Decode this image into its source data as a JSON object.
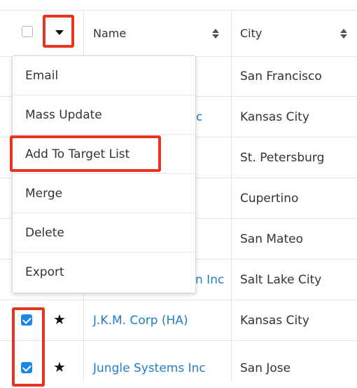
{
  "header": {
    "name_label": "Name",
    "city_label": "City"
  },
  "rows": [
    {
      "name": "",
      "city": "San Francisco",
      "checked": false,
      "starred": false
    },
    {
      "name": "c",
      "city": "Kansas City",
      "checked": false,
      "starred": false
    },
    {
      "name": "",
      "city": "St. Petersburg",
      "checked": false,
      "starred": false
    },
    {
      "name": "",
      "city": "Cupertino",
      "checked": false,
      "starred": false
    },
    {
      "name": "",
      "city": "San Mateo",
      "checked": false,
      "starred": false
    },
    {
      "name": "n Inc",
      "city": "Salt Lake City",
      "checked": false,
      "starred": false
    },
    {
      "name": "J.K.M. Corp (HA)",
      "city": "Kansas City",
      "checked": true,
      "starred": true
    },
    {
      "name": "Jungle Systems Inc",
      "city": "San Jose",
      "checked": true,
      "starred": true
    }
  ],
  "actions_menu": {
    "items": [
      "Email",
      "Mass Update",
      "Add To Target List",
      "Merge",
      "Delete",
      "Export"
    ]
  },
  "colors": {
    "highlight": "#e8331e",
    "link": "#1e7fc7",
    "checkbox_checked": "#1f86e0"
  },
  "icons": {
    "sort": "sort-icon",
    "star": "star-icon",
    "caret": "chevron-down-icon"
  }
}
